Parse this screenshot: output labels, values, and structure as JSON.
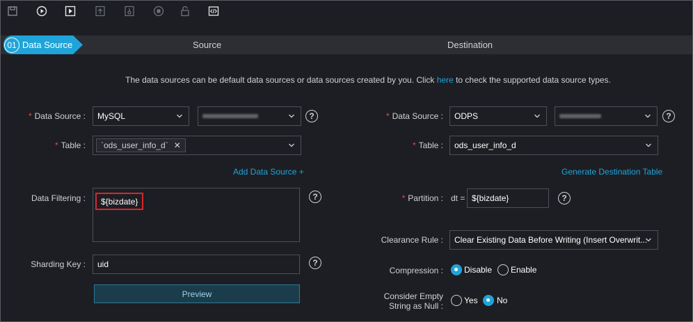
{
  "toolbar": {
    "buttons": [
      {
        "icon": "save-icon"
      },
      {
        "icon": "run-icon"
      },
      {
        "icon": "run-with-params-icon"
      },
      {
        "icon": "submit-icon"
      },
      {
        "icon": "deploy-icon"
      },
      {
        "icon": "stop-icon"
      },
      {
        "icon": "lock-icon"
      },
      {
        "icon": "code-view-icon"
      }
    ]
  },
  "steps": {
    "active_number": "01",
    "active_label": "Data Source",
    "source_label": "Source",
    "destination_label": "Destination"
  },
  "hint": {
    "before": "The data sources can be default data sources or data sources created by you. Click ",
    "link": "here",
    "after": " to check the supported data source types."
  },
  "source": {
    "data_source_label": "Data Source",
    "data_source_type": "MySQL",
    "table_label": "Table",
    "table_tag": "`ods_user_info_d`",
    "add_data_source": "Add Data Source +",
    "filter_label": "Data Filtering",
    "filter_value": "${bizdate}",
    "shard_label": "Sharding Key",
    "shard_value": "uid",
    "preview_label": "Preview"
  },
  "destination": {
    "data_source_label": "Data Source",
    "data_source_type": "ODPS",
    "table_label": "Table",
    "table_value": "ods_user_info_d",
    "generate_table": "Generate Destination Table",
    "partition_label": "Partition",
    "partition_prefix": "dt =",
    "partition_value": "${bizdate}",
    "clearance_label": "Clearance Rule",
    "clearance_value": "Clear Existing Data Before Writing (Insert Overwrit...",
    "compression_label": "Compression",
    "compression_options": [
      "Disable",
      "Enable"
    ],
    "compression_selected": "Disable",
    "empty_null_label_1": "Consider Empty",
    "empty_null_label_2": "String as Null",
    "empty_null_options": [
      "Yes",
      "No"
    ],
    "empty_null_selected": "No"
  },
  "colors": {
    "accent": "#1fa4d9",
    "required": "#e34a4a",
    "highlight_border": "#d9262d",
    "background": "#1d1e23"
  }
}
